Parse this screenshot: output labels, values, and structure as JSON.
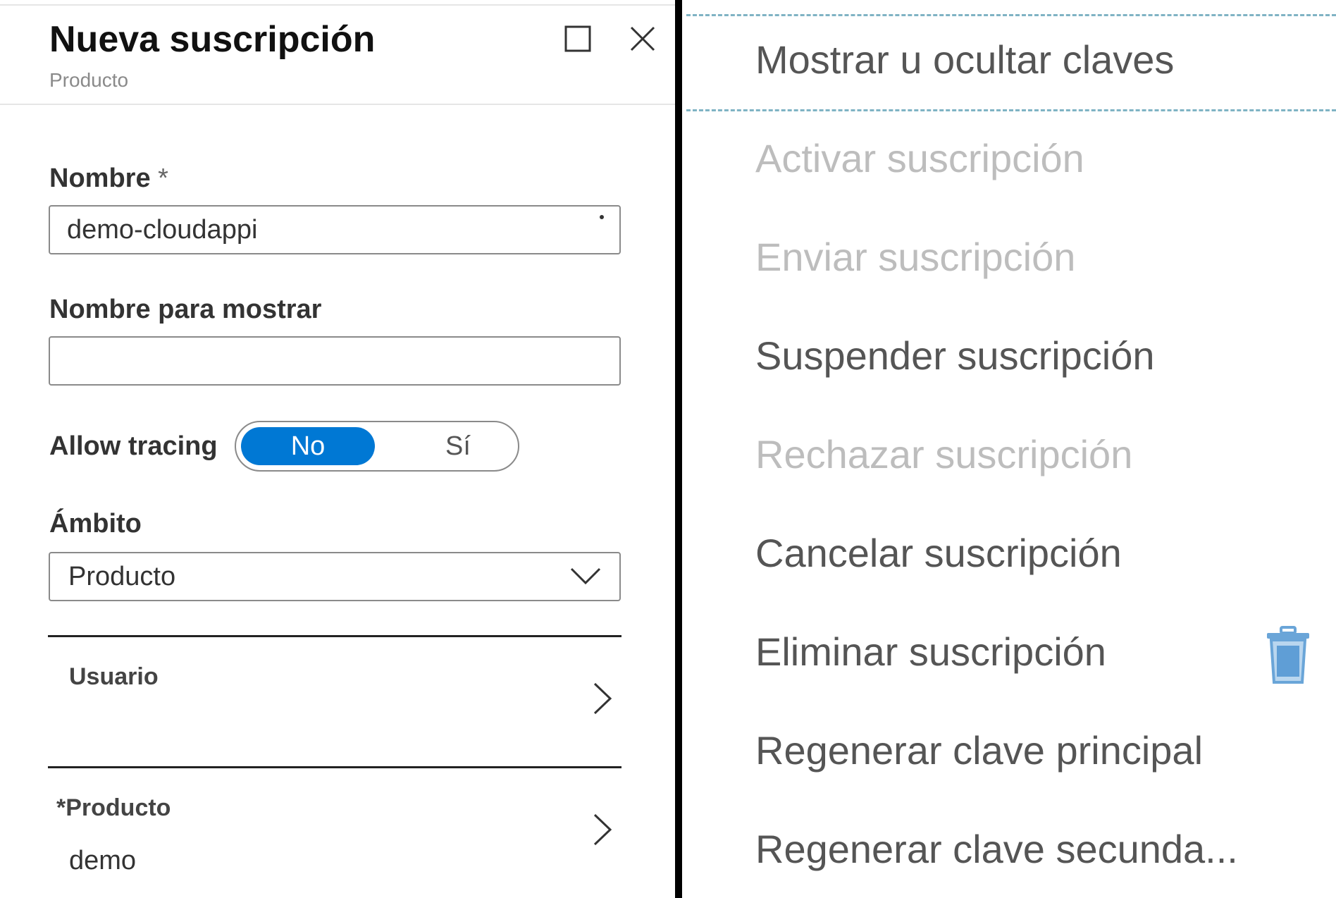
{
  "blade": {
    "title": "Nueva suscripción",
    "subtitle": "Producto",
    "name_label": "Nombre",
    "name_required_mark": "*",
    "name_value": "demo-cloudappi",
    "display_name_label": "Nombre para mostrar",
    "display_name_value": "",
    "tracing_label": "Allow tracing",
    "tracing_options": [
      "No",
      "Sí"
    ],
    "tracing_selected": "No",
    "scope_label": "Ámbito",
    "scope_value": "Producto",
    "user_picker_label": "Usuario",
    "product_picker_label": "*Producto",
    "product_picker_value": "demo"
  },
  "menu": {
    "items": [
      {
        "label": "Mostrar u ocultar claves",
        "enabled": true,
        "focused": true
      },
      {
        "label": "Activar suscripción",
        "enabled": false
      },
      {
        "label": "Enviar suscripción",
        "enabled": false
      },
      {
        "label": "Suspender suscripción",
        "enabled": true
      },
      {
        "label": "Rechazar suscripción",
        "enabled": false
      },
      {
        "label": "Cancelar suscripción",
        "enabled": true
      },
      {
        "label": "Eliminar suscripción",
        "enabled": true,
        "icon": "trash-icon"
      },
      {
        "label": "Regenerar clave principal",
        "enabled": true
      },
      {
        "label": "Regenerar clave secunda...",
        "enabled": true
      }
    ]
  },
  "colors": {
    "accent": "#0078d4",
    "focus_outline": "#7fb3c4",
    "disabled_text": "#bdbdbd",
    "trash_icon": "#6aa5d8"
  }
}
